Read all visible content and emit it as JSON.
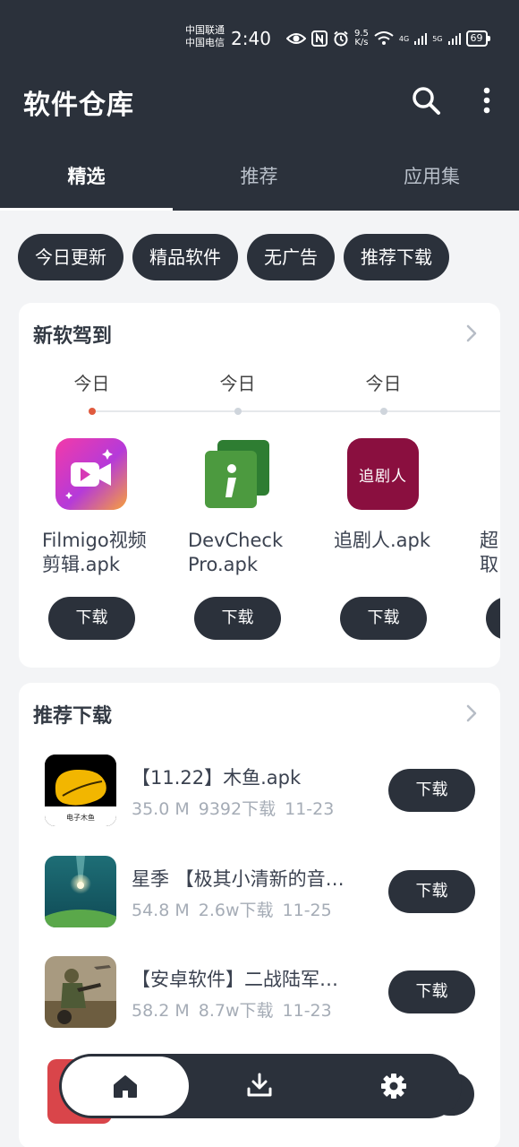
{
  "status_bar": {
    "carrier_1": "中国联通",
    "carrier_2": "中国电信",
    "time": "2:40",
    "net_speed_value": "9.5",
    "net_speed_unit": "K/s",
    "signal_1": "4G",
    "signal_2": "5G",
    "battery": "69"
  },
  "app_bar": {
    "title": "软件仓库",
    "icons": [
      "search-icon",
      "more-vert-icon"
    ]
  },
  "tabs": [
    {
      "label": "精选",
      "active": true
    },
    {
      "label": "推荐",
      "active": false
    },
    {
      "label": "应用集",
      "active": false
    }
  ],
  "chips": [
    "今日更新",
    "精品软件",
    "无广告",
    "推荐下载"
  ],
  "new_section": {
    "title": "新软驾到",
    "items": [
      {
        "day": "今日",
        "name": "Filmigo视频剪辑.apk",
        "button": "下载"
      },
      {
        "day": "今日",
        "name": "DevCheck Pro.apk",
        "button": "下载"
      },
      {
        "day": "今日",
        "name": "追剧人.apk",
        "button": "下载",
        "icon_text": "追剧人"
      },
      {
        "day": "",
        "name": "超取",
        "button": ""
      }
    ]
  },
  "recommend_section": {
    "title": "推荐下载",
    "items": [
      {
        "name": "【11.22】木鱼.apk",
        "size": "35.0 M",
        "downloads": "9392下载",
        "date": "11-23",
        "button": "下载",
        "icon_text": "电子木鱼"
      },
      {
        "name": "星季 【极其小清新的音…",
        "size": "54.8 M",
        "downloads": "2.6w下载",
        "date": "11-25",
        "button": "下载"
      },
      {
        "name": "【安卓软件】二战陆军…",
        "size": "58.2 M",
        "downloads": "8.7w下载",
        "date": "11-23",
        "button": "下载"
      }
    ]
  },
  "bottom_nav": {
    "icons": [
      "home-icon",
      "download-icon",
      "settings-icon"
    ],
    "active": "home-icon"
  },
  "colors": {
    "dark": "#2b313b",
    "accent_dot": "#e05a3e",
    "background": "#f3f4f6"
  }
}
